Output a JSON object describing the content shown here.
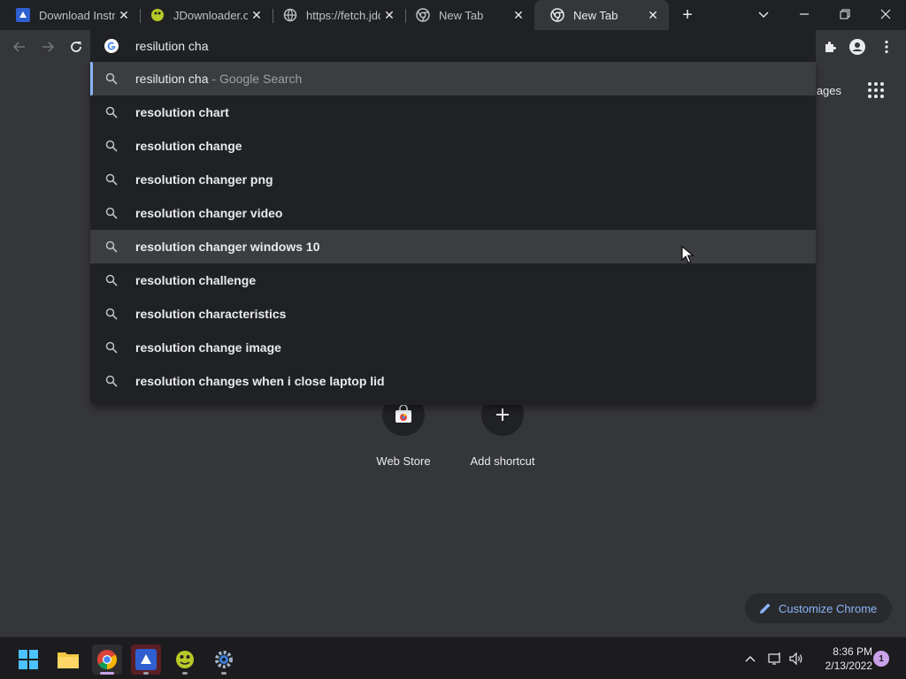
{
  "tabs": [
    {
      "title": "Download Instr",
      "icon": "jdownloader-icon",
      "active": false
    },
    {
      "title": "JDownloader.or",
      "icon": "jdownloader-frog-icon",
      "active": false
    },
    {
      "title": "https://fetch.jdc",
      "icon": "globe-icon",
      "active": false
    },
    {
      "title": "New Tab",
      "icon": "chrome-icon",
      "active": false
    },
    {
      "title": "New Tab",
      "icon": "chrome-icon",
      "active": true
    }
  ],
  "omnibox": {
    "value": "resilution cha"
  },
  "suggestions": [
    {
      "typed": "resilution cha",
      "rest": "",
      "suffix": " - Google Search"
    },
    {
      "typed": "resolution cha",
      "rest": "rt",
      "suffix": ""
    },
    {
      "typed": "resolution cha",
      "rest": "nge",
      "suffix": ""
    },
    {
      "typed": "resolution cha",
      "rest": "nger png",
      "suffix": ""
    },
    {
      "typed": "resolution cha",
      "rest": "nger video",
      "suffix": ""
    },
    {
      "typed": "resolution cha",
      "rest": "nger windows 10",
      "suffix": ""
    },
    {
      "typed": "resolution cha",
      "rest": "llenge",
      "suffix": ""
    },
    {
      "typed": "resolution cha",
      "rest": "racteristics",
      "suffix": ""
    },
    {
      "typed": "resolution cha",
      "rest": "nge image",
      "suffix": ""
    },
    {
      "typed": "resolution cha",
      "rest": "nges when i close laptop lid",
      "suffix": ""
    }
  ],
  "ntp": {
    "images_link": "mages",
    "shortcuts": [
      {
        "label": "Web Store"
      },
      {
        "label": "Add shortcut"
      }
    ],
    "customize_label": "Customize Chrome"
  },
  "taskbar": {
    "time": "8:36 PM",
    "date": "2/13/2022",
    "notification_count": "1"
  },
  "colors": {
    "accent": "#8ab4f8",
    "background": "#35363a",
    "surface": "#202124"
  }
}
